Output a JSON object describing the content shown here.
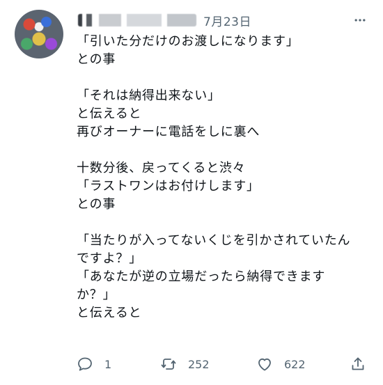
{
  "tweet": {
    "date": "7月23日",
    "lines": [
      "「引いた分だけのお渡しになります」",
      "との事",
      "",
      "「それは納得出来ない」",
      "と伝えると",
      "再びオーナーに電話をしに裏へ",
      "",
      "十数分後、戻ってくると渋々",
      "「ラストワンはお付けします」",
      "との事",
      "",
      "「当たりが入ってないくじを引かされていたん",
      "ですよ？」",
      "「あなたが逆の立場だったら納得できます",
      "か？」",
      "と伝えると"
    ],
    "text": "「引いた分だけのお渡しになります」\nとの事\n\n「それは納得出来ない」\nと伝えると\n再びオーナーに電話をしに裏へ\n\n十数分後、戻ってくると渋々\n「ラストワンはお付けします」\nとの事\n\n「当たりが入ってないくじを引かされていたん\nですよ？」\n「あなたが逆の立場だったら納得できます\nか？」\nと伝えると",
    "reply_count": "1",
    "retweet_count": "252",
    "like_count": "622",
    "icons": {
      "more": "more-horizontal-icon",
      "reply": "reply-icon",
      "retweet": "retweet-icon",
      "like": "heart-icon",
      "share": "share-icon"
    },
    "colors": {
      "text": "#0f1419",
      "muted": "#536471",
      "background": "#ffffff"
    }
  }
}
